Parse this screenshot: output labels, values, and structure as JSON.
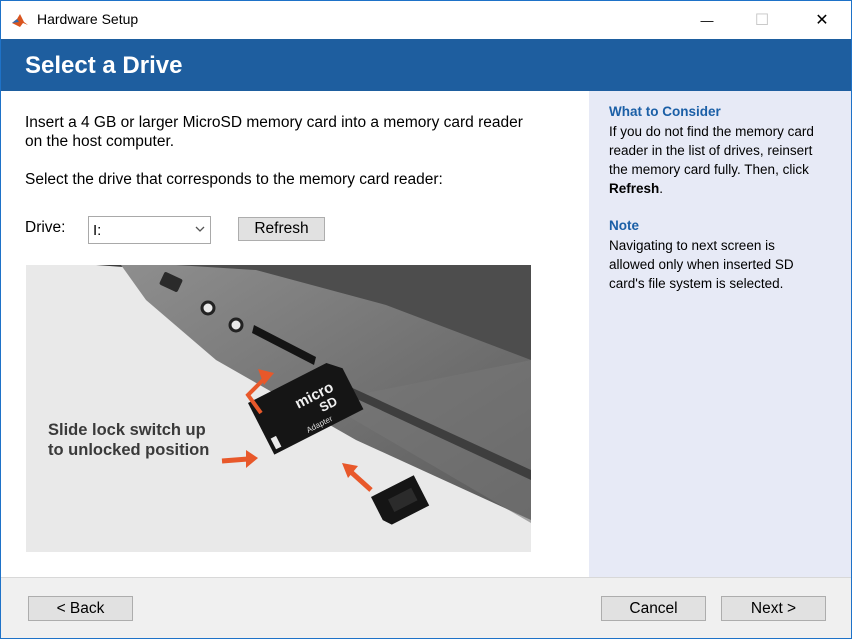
{
  "window": {
    "title": "Hardware Setup",
    "minimize_glyph": "—",
    "maximize_glyph": "☐",
    "close_glyph": "✕"
  },
  "header": {
    "title": "Select a Drive"
  },
  "main": {
    "instruction_line1": "Insert a 4 GB or larger MicroSD memory card into a memory card reader",
    "instruction_line2": "on the host computer.",
    "select_instruction": "Select the drive that corresponds to the memory card reader:",
    "drive_label": "Drive:",
    "drive_value": "I:",
    "refresh_button": "Refresh",
    "image": {
      "caption_line1": "Slide lock switch up",
      "caption_line2": "to unlocked position",
      "card_text_micro": "micro",
      "card_text_sd": "SD",
      "card_text_adapter": "Adapter"
    }
  },
  "side_panel": {
    "consider_heading": "What to Consider",
    "consider_line1": "If you do not find the memory card",
    "consider_line2": "reader in the list of drives, reinsert",
    "consider_line3": "the memory card fully. Then, click",
    "consider_bold": "Refresh",
    "consider_end": ".",
    "note_heading": "Note",
    "note_line1": "Navigating to next screen is",
    "note_line2": "allowed only when inserted SD",
    "note_line3": "card's file system is selected."
  },
  "footer": {
    "back_button": "< Back",
    "cancel_button": "Cancel",
    "next_button": "Next >"
  },
  "colors": {
    "header_blue": "#1e5e9f",
    "side_panel_bg": "#e7eaf6",
    "side_heading": "#1b5fa6",
    "arrow_orange": "#e8582a"
  }
}
